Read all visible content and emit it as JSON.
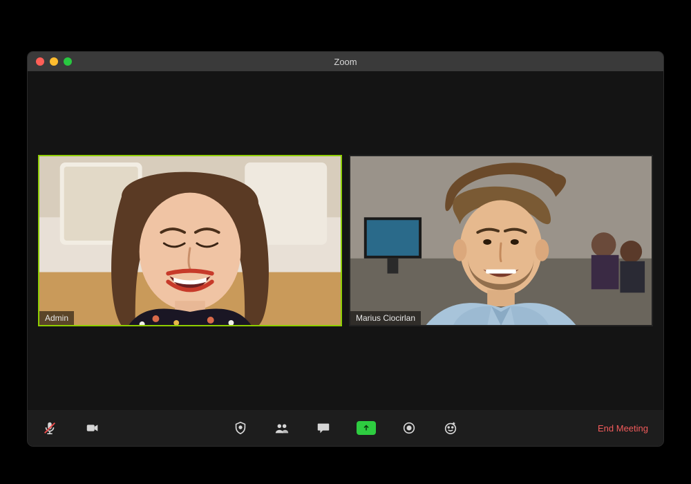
{
  "window": {
    "title": "Zoom"
  },
  "participants": [
    {
      "name": "Admin",
      "speaking": true
    },
    {
      "name": "Marius Ciocirlan",
      "speaking": false
    }
  ],
  "toolbar": {
    "end_label": "End Meeting"
  }
}
